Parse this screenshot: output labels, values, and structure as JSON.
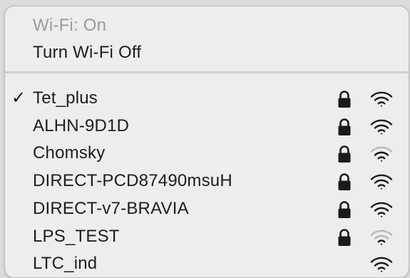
{
  "header": {
    "wifi_status": "Wi-Fi: On",
    "toggle_label": "Turn Wi-Fi Off"
  },
  "networks": [
    {
      "name": "Tet_plus",
      "connected": true,
      "locked": true,
      "signal": 3
    },
    {
      "name": "ALHN-9D1D",
      "connected": false,
      "locked": true,
      "signal": 3
    },
    {
      "name": "Chomsky",
      "connected": false,
      "locked": true,
      "signal": 2
    },
    {
      "name": "DIRECT-PCD87490msuH",
      "connected": false,
      "locked": true,
      "signal": 3
    },
    {
      "name": "DIRECT-v7-BRAVIA",
      "connected": false,
      "locked": true,
      "signal": 3
    },
    {
      "name": "LPS_TEST",
      "connected": false,
      "locked": true,
      "signal": 1
    },
    {
      "name": "LTC_ind",
      "connected": false,
      "locked": false,
      "signal": 3
    }
  ],
  "icons": {
    "checkmark": "✓",
    "lock": "lock-icon",
    "wifi": "wifi-icon"
  },
  "colors": {
    "menu_bg": "#ededed",
    "text": "#1d1d1d",
    "disabled_text": "#9a9a9a",
    "wifi_active": "#1a1a1a",
    "wifi_dim": "#b8b8b8"
  }
}
